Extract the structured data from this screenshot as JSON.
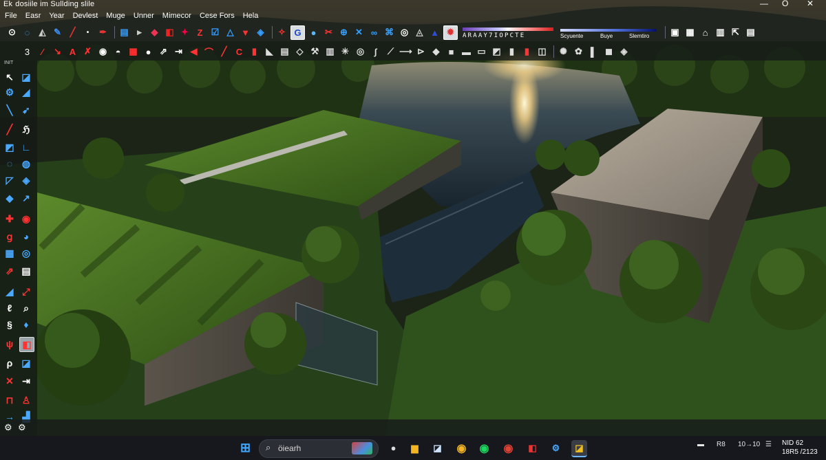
{
  "window": {
    "title_prefix": "Ek",
    "title": "dosiile im   Sullding slile",
    "min_label": "—",
    "max_label": "O",
    "close_label": "✕"
  },
  "menu": [
    "File",
    "Easr",
    "Year",
    "Devlest",
    "Muge",
    "Unner",
    "Mimecor",
    "Cese Fors",
    "Hela"
  ],
  "toolbar": {
    "row1_leading_arrow": "•",
    "ramp_label": "ARAAY7IOPCTE",
    "ramp2_labels": [
      "Scyuente",
      "Buye",
      "Slemtiro"
    ]
  },
  "toolbar2": {
    "leading_number": "3"
  },
  "left_panel": {
    "header": "INIT"
  },
  "taskbar": {
    "search_placeholder": "öiearh",
    "tray_text_1": "R8",
    "tray_text_2": "10→10",
    "time": "NID 62",
    "date": "18R5 /2123"
  },
  "colors": {
    "grass": "#3f6a1e",
    "water": "#1f2f3a",
    "concrete": "#8c857a",
    "sun": "#fff3c0"
  }
}
